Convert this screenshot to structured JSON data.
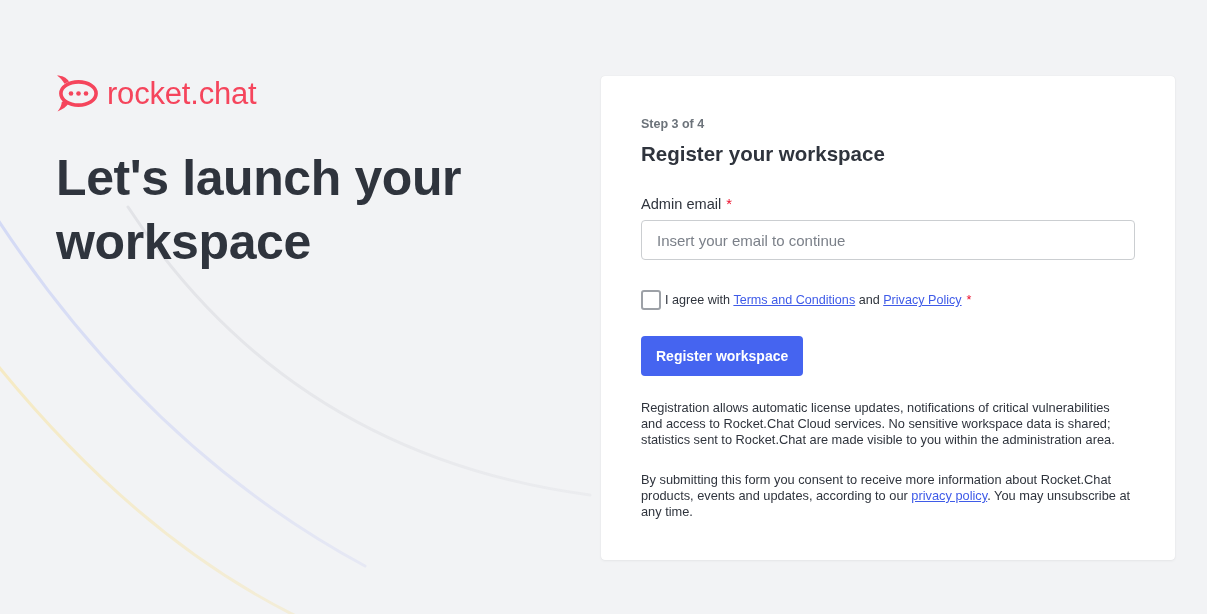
{
  "brand": {
    "name": "rocket.chat"
  },
  "hero": {
    "heading": "Let's launch your workspace"
  },
  "form": {
    "step": "Step 3 of 4",
    "title": "Register your workspace",
    "email": {
      "label": "Admin email",
      "required_mark": "*",
      "placeholder": "Insert your email to continue"
    },
    "agreement": {
      "checked": false,
      "parts": [
        {
          "kind": "text",
          "text": "I agree with "
        },
        {
          "kind": "link",
          "text": "Terms and Conditions"
        },
        {
          "kind": "text",
          "text": " and "
        },
        {
          "kind": "link",
          "text": "Privacy Policy"
        }
      ],
      "required_mark": "*"
    },
    "submit_button": "Register workspace",
    "notes": [
      {
        "parts": [
          {
            "kind": "text",
            "text": "Registration allows automatic license updates, notifications of critical vulnerabilities and access to Rocket.Chat Cloud services. No sensitive workspace data is shared; statistics sent to Rocket.Chat are made visible to you within the administration area."
          }
        ]
      },
      {
        "parts": [
          {
            "kind": "text",
            "text": "By submitting this form you consent to receive more information about Rocket.Chat products, events and updates, according to our "
          },
          {
            "kind": "link",
            "text": "privacy policy"
          },
          {
            "kind": "text",
            "text": ". You may unsubscribe at any time."
          }
        ]
      }
    ]
  }
}
